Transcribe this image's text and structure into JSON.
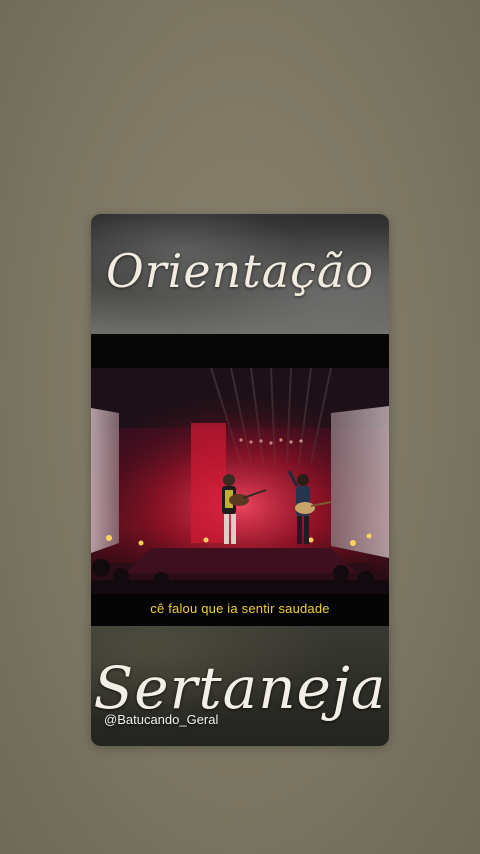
{
  "story": {
    "top_title": "Orientação",
    "subtitle": "cê falou que ia sentir saudade",
    "bottom_title": "Sertaneja",
    "handle": "@Batucando_Geral"
  },
  "colors": {
    "background": "#7c7663",
    "subtitle_text": "#f1cf2a",
    "stage_red": "#b0142a"
  }
}
